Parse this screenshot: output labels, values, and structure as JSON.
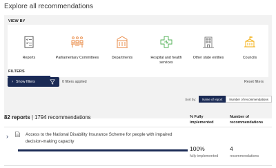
{
  "page": {
    "title": "Explore all recommendations"
  },
  "view_by": {
    "label": "VIEW BY",
    "items": [
      {
        "label": "Reports",
        "icon": "checklist-icon",
        "active": true
      },
      {
        "label": "Parliamentary Committees",
        "icon": "people-group-icon",
        "active": false
      },
      {
        "label": "Departments",
        "icon": "building-icon",
        "active": false
      },
      {
        "label": "Hospital and health services",
        "icon": "hospital-cross-icon",
        "active": false
      },
      {
        "label": "Other state entities",
        "icon": "office-building-icon",
        "active": false
      },
      {
        "label": "Councils",
        "icon": "council-flag-icon",
        "active": false
      }
    ]
  },
  "filters": {
    "label": "FILTERS",
    "show_button": "Show filters",
    "applied_text": "0 filters applied",
    "reset_text": "Reset filters"
  },
  "sort": {
    "label": "Sort by:",
    "options": [
      "Name of report",
      "Number of recommendations"
    ],
    "selected": "Name of report"
  },
  "summary": {
    "reports_count": "82 reports",
    "recommendations_text": "| 1794 recommendations"
  },
  "columns": {
    "pct_header": "% Fully implemented",
    "num_header": "Number of recommendations"
  },
  "rows": [
    {
      "title": "Access to the National Disability Insurance Scheme for people with impaired decision-making capacity",
      "pct_value": "100%",
      "pct_fraction": 1.0,
      "pct_caption": "fully implemented",
      "num_value": "4",
      "num_caption": "recommendations"
    }
  ],
  "colors": {
    "accent": "#1b2b55",
    "icon_orange": "#e8833a",
    "icon_green": "#4caf50",
    "icon_gold": "#f2a900",
    "icon_gray": "#777777",
    "panel_bg": "#f2f2f2"
  }
}
